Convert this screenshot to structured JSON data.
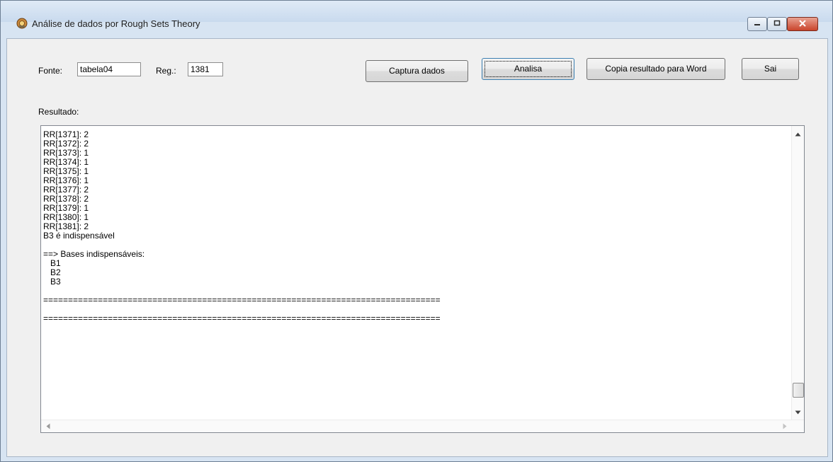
{
  "window": {
    "title": "Análise de dados por Rough Sets Theory",
    "app_icon": "app-icon"
  },
  "title_controls": {
    "minimize_icon": "minimize-icon",
    "maximize_icon": "maximize-icon",
    "close_icon": "close-icon"
  },
  "form": {
    "fonte_label": "Fonte:",
    "fonte_value": "tabela04",
    "reg_label": "Reg.:",
    "reg_value": "1381",
    "resultado_label": "Resultado:"
  },
  "buttons": {
    "captura": "Captura dados",
    "analisa": "Analisa",
    "copia": "Copia resultado para Word",
    "sai": "Sai"
  },
  "result_lines": [
    "RR[1371]: 2",
    "RR[1372]: 2",
    "RR[1373]: 1",
    "RR[1374]: 1",
    "RR[1375]: 1",
    "RR[1376]: 1",
    "RR[1377]: 2",
    "RR[1378]: 2",
    "RR[1379]: 1",
    "RR[1380]: 1",
    "RR[1381]: 2",
    "B3 é indispensável",
    "",
    "==> Bases indispensáveis:",
    "   B1",
    "   B2",
    "   B3",
    "",
    "================================================================================",
    "",
    "================================================================================"
  ],
  "colors": {
    "close_button": "#c9442b",
    "frame": "#d7e4f2",
    "client_bg": "#f0f0f0"
  }
}
